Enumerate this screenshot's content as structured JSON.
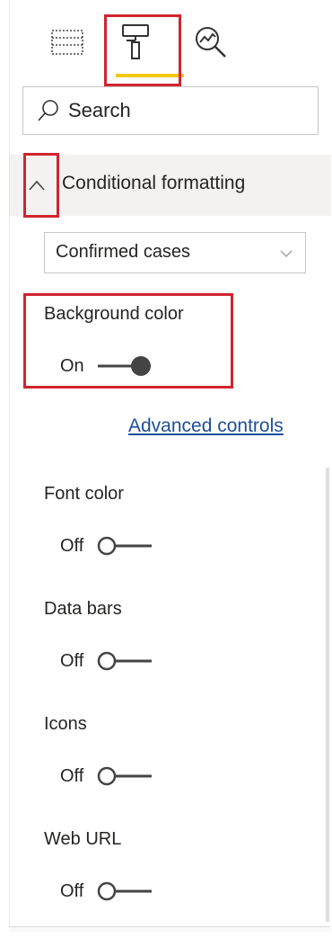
{
  "tabs": [
    {
      "icon": "fields-icon",
      "active": false
    },
    {
      "icon": "paint-roller-icon",
      "active": true
    },
    {
      "icon": "analytics-icon",
      "active": false
    }
  ],
  "search": {
    "placeholder": "Search"
  },
  "section": {
    "title": "Conditional formatting",
    "expanded": true
  },
  "dropdown": {
    "value": "Confirmed cases"
  },
  "background_color": {
    "label": "Background color",
    "state": "On"
  },
  "advanced_controls": "Advanced controls",
  "settings": [
    {
      "label": "Font color",
      "state": "Off"
    },
    {
      "label": "Data bars",
      "state": "Off"
    },
    {
      "label": "Icons",
      "state": "Off"
    },
    {
      "label": "Web URL",
      "state": "Off"
    }
  ],
  "colors": {
    "accent": "#f2c811",
    "highlight": "#d1242f",
    "link": "#1e4e9c"
  }
}
